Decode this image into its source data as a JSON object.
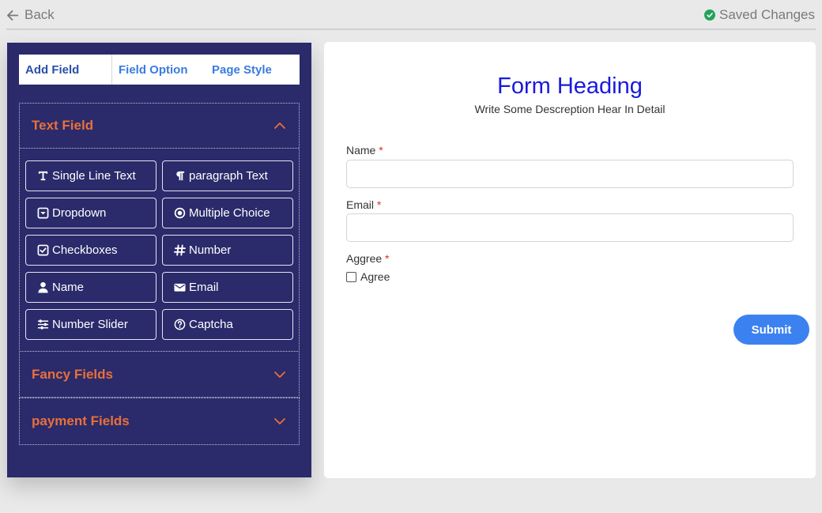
{
  "topbar": {
    "back_label": "Back",
    "saved_label": "Saved Changes"
  },
  "sidebar": {
    "tabs": [
      {
        "label": "Add Field"
      },
      {
        "label": "Field Option"
      },
      {
        "label": "Page Style"
      }
    ],
    "sections": [
      {
        "title": "Text Field",
        "expanded": true,
        "buttons": [
          {
            "label": "Single Line Text",
            "icon": "text-cursor-icon"
          },
          {
            "label": "paragraph Text",
            "icon": "paragraph-icon"
          },
          {
            "label": "Dropdown",
            "icon": "dropdown-icon"
          },
          {
            "label": "Multiple Choice",
            "icon": "radio-icon"
          },
          {
            "label": "Checkboxes",
            "icon": "checkbox-icon"
          },
          {
            "label": "Number",
            "icon": "hash-icon"
          },
          {
            "label": "Name",
            "icon": "user-icon"
          },
          {
            "label": "Email",
            "icon": "envelope-icon"
          },
          {
            "label": "Number Slider",
            "icon": "sliders-icon"
          },
          {
            "label": "Captcha",
            "icon": "question-circle-icon"
          }
        ]
      },
      {
        "title": "Fancy Fields",
        "expanded": false
      },
      {
        "title": "payment Fields",
        "expanded": false
      }
    ]
  },
  "form": {
    "heading": "Form Heading",
    "description": "Write Some Descreption Hear In Detail",
    "fields": [
      {
        "label": "Name",
        "required_mark": "*",
        "value": ""
      },
      {
        "label": "Email",
        "required_mark": "*",
        "value": ""
      },
      {
        "label": "Aggree",
        "required_mark": "*",
        "checkbox_label": "Agree"
      }
    ],
    "submit_label": "Submit"
  },
  "colors": {
    "sidebar_bg": "#2b2a6b",
    "section_title": "#e8703a",
    "heading": "#1a1adb",
    "submit": "#3b82f0",
    "saved_check": "#22a35a"
  }
}
